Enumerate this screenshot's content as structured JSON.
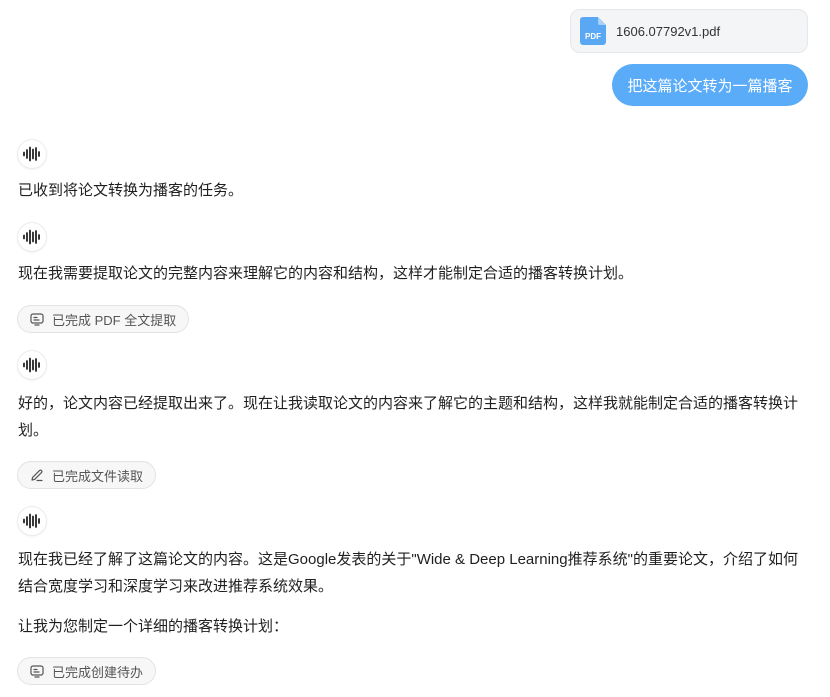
{
  "attachment": {
    "file_name": "1606.07792v1.pdf",
    "icon": "pdf-file-icon",
    "icon_label": "PDF"
  },
  "user_message": "把这篇论文转为一篇播客",
  "assistant": {
    "avatar_icon": "waveform-icon",
    "messages": [
      "已收到将论文转换为播客的任务。",
      "现在我需要提取论文的完整内容来理解它的内容和结构，这样才能制定合适的播客转换计划。",
      "好的，论文内容已经提取出来了。现在让我读取论文的内容来了解它的主题和结构，这样我就能制定合适的播客转换计划。",
      "现在我已经了解了这篇论文的内容。这是Google发表的关于\"Wide & Deep Learning推荐系统\"的重要论文，介绍了如何结合宽度学习和深度学习来改进推荐系统效果。",
      "让我为您制定一个详细的播客转换计划："
    ],
    "steps": [
      {
        "label": "已完成 PDF 全文提取",
        "icon": "terminal-icon"
      },
      {
        "label": "已完成文件读取",
        "icon": "pencil-icon"
      },
      {
        "label": "已完成创建待办",
        "icon": "terminal-icon"
      }
    ]
  },
  "colors": {
    "user_bubble": "#5aabf8",
    "pdf_icon": "#5aa7f4"
  }
}
